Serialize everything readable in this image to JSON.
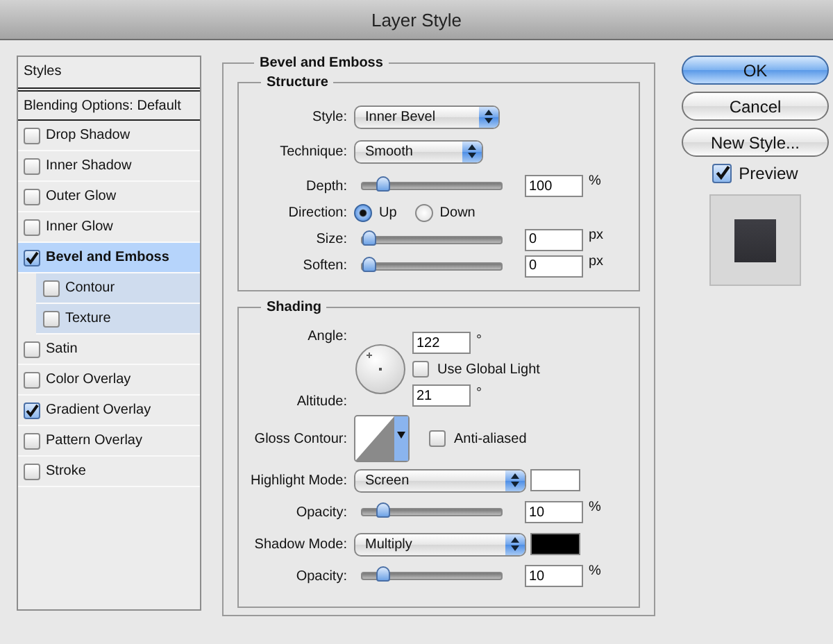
{
  "window": {
    "title": "Layer Style"
  },
  "sidebar": {
    "header": "Styles",
    "items": [
      {
        "kind": "plain",
        "label": "Blending Options: Default",
        "selected": false
      },
      {
        "kind": "checkbox",
        "label": "Drop Shadow",
        "checked": false,
        "selected": false
      },
      {
        "kind": "checkbox",
        "label": "Inner Shadow",
        "checked": false,
        "selected": false
      },
      {
        "kind": "checkbox",
        "label": "Outer Glow",
        "checked": false,
        "selected": false
      },
      {
        "kind": "checkbox",
        "label": "Inner Glow",
        "checked": false,
        "selected": false
      },
      {
        "kind": "checkbox",
        "label": "Bevel and Emboss",
        "checked": true,
        "selected": true,
        "children": [
          {
            "kind": "checkbox",
            "label": "Contour",
            "checked": false,
            "selected": false
          },
          {
            "kind": "checkbox",
            "label": "Texture",
            "checked": false,
            "selected": false
          }
        ]
      },
      {
        "kind": "checkbox",
        "label": "Satin",
        "checked": false,
        "selected": false
      },
      {
        "kind": "checkbox",
        "label": "Color Overlay",
        "checked": false,
        "selected": false
      },
      {
        "kind": "checkbox",
        "label": "Gradient Overlay",
        "checked": true,
        "selected": false
      },
      {
        "kind": "checkbox",
        "label": "Pattern Overlay",
        "checked": false,
        "selected": false
      },
      {
        "kind": "checkbox",
        "label": "Stroke",
        "checked": false,
        "selected": false
      }
    ]
  },
  "panel": {
    "title": "Bevel and Emboss",
    "structure": {
      "title": "Structure",
      "style": {
        "label": "Style:",
        "value": "Inner Bevel"
      },
      "technique": {
        "label": "Technique:",
        "value": "Smooth"
      },
      "depth": {
        "label": "Depth:",
        "level": 0.1,
        "value": "100",
        "unit": "%"
      },
      "direction": {
        "label": "Direction:",
        "options": [
          {
            "label": "Up",
            "selected": true
          },
          {
            "label": "Down",
            "selected": false
          }
        ]
      },
      "size": {
        "label": "Size:",
        "level": 0,
        "value": "0",
        "unit": "px"
      },
      "soften": {
        "label": "Soften:",
        "level": 0,
        "value": "0",
        "unit": "px"
      }
    },
    "shading": {
      "title": "Shading",
      "angle": {
        "label": "Angle:",
        "value": "122",
        "unit": "°"
      },
      "global_light": {
        "label": "Use Global Light",
        "checked": false
      },
      "altitude": {
        "label": "Altitude:",
        "value": "21",
        "unit": "°"
      },
      "gloss_contour": {
        "label": "Gloss Contour:"
      },
      "anti_aliased": {
        "label": "Anti-aliased",
        "checked": false
      },
      "highlight_mode": {
        "label": "Highlight Mode:",
        "value": "Screen",
        "color": "#ffffff"
      },
      "highlight_opacity": {
        "label": "Opacity:",
        "level": 0.1,
        "value": "10",
        "unit": "%"
      },
      "shadow_mode": {
        "label": "Shadow Mode:",
        "value": "Multiply",
        "color": "#000000"
      },
      "shadow_opacity": {
        "label": "Opacity:",
        "level": 0.1,
        "value": "10",
        "unit": "%"
      }
    }
  },
  "buttons": [
    {
      "label": "OK",
      "default": true
    },
    {
      "label": "Cancel",
      "default": false
    },
    {
      "label": "New Style...",
      "default": false
    }
  ],
  "preview": {
    "label": "Preview",
    "checked": true
  }
}
